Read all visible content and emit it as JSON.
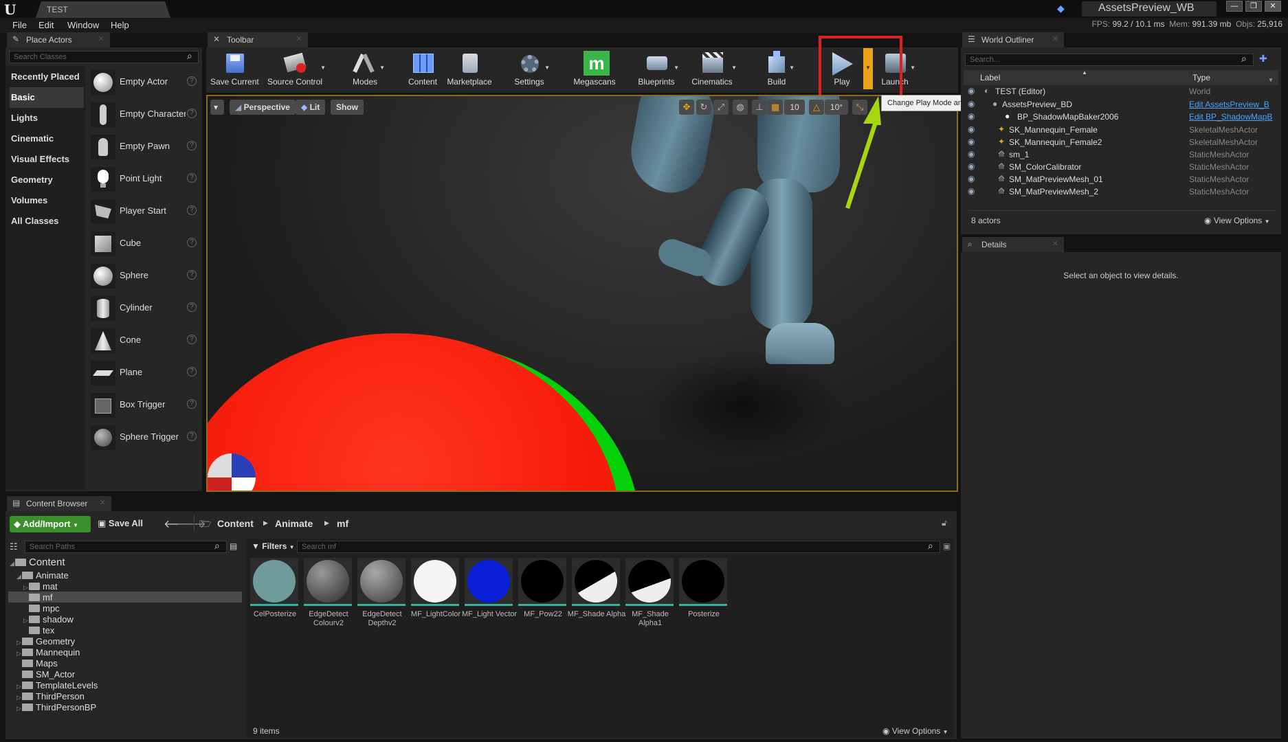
{
  "window": {
    "doc_tab": "TEST",
    "title": "AssetsPreview_WB",
    "controls": [
      "—",
      "❐",
      "✕"
    ]
  },
  "menu": [
    "File",
    "Edit",
    "Window",
    "Help"
  ],
  "stats": {
    "fps_label": "FPS:",
    "fps": "99.2",
    "ms": "/ 10.1 ms",
    "mem_label": "Mem:",
    "mem": "991.39 mb",
    "objs_label": "Objs:",
    "objs": "25,916"
  },
  "place_actors": {
    "tab": "Place Actors",
    "search_placeholder": "Search Classes",
    "categories": [
      "Recently Placed",
      "Basic",
      "Lights",
      "Cinematic",
      "Visual Effects",
      "Geometry",
      "Volumes",
      "All Classes"
    ],
    "selected_category": "Basic",
    "actors": [
      "Empty Actor",
      "Empty Character",
      "Empty Pawn",
      "Point Light",
      "Player Start",
      "Cube",
      "Sphere",
      "Cylinder",
      "Cone",
      "Plane",
      "Box Trigger",
      "Sphere Trigger"
    ]
  },
  "toolbar": {
    "tab": "Toolbar",
    "buttons": [
      "Save Current",
      "Source Control",
      "Modes",
      "Content",
      "Marketplace",
      "Settings",
      "Megascans",
      "Blueprints",
      "Cinematics",
      "Build",
      "Play",
      "Launch"
    ],
    "tooltip": "Change Play Mode and Play Settings"
  },
  "viewport": {
    "perspective": "Perspective",
    "lit": "Lit",
    "show": "Show",
    "grid_snap": "10",
    "rot_snap": "10°"
  },
  "outliner": {
    "tab": "World Outliner",
    "search_placeholder": "Search...",
    "col_label": "Label",
    "col_type": "Type",
    "rows": [
      {
        "label": "TEST (Editor)",
        "type": "World",
        "link": false
      },
      {
        "label": "AssetsPreview_BD",
        "type": "Edit AssetsPreview_B",
        "link": true
      },
      {
        "label": "BP_ShadowMapBaker2006",
        "type": "Edit BP_ShadowMapB",
        "link": true
      },
      {
        "label": "SK_Mannequin_Female",
        "type": "SkeletalMeshActor",
        "link": false
      },
      {
        "label": "SK_Mannequin_Female2",
        "type": "SkeletalMeshActor",
        "link": false
      },
      {
        "label": "sm_1",
        "type": "StaticMeshActor",
        "link": false
      },
      {
        "label": "SM_ColorCalibrator",
        "type": "StaticMeshActor",
        "link": false
      },
      {
        "label": "SM_MatPreviewMesh_01",
        "type": "StaticMeshActor",
        "link": false
      },
      {
        "label": "SM_MatPreviewMesh_2",
        "type": "StaticMeshActor",
        "link": false
      }
    ],
    "count": "8 actors",
    "view_options": "View Options"
  },
  "details": {
    "tab": "Details",
    "empty": "Select an object to view details."
  },
  "content_browser": {
    "tab": "Content Browser",
    "add_import": "Add/Import",
    "save_all": "Save All",
    "path": [
      "Content",
      "Animate",
      "mf"
    ],
    "search_paths": "Search Paths",
    "filters": "Filters",
    "search_placeholder": "Search mf",
    "tree": [
      {
        "name": "Content",
        "depth": 0
      },
      {
        "name": "Animate",
        "depth": 1
      },
      {
        "name": "mat",
        "depth": 2
      },
      {
        "name": "mf",
        "depth": 2
      },
      {
        "name": "mpc",
        "depth": 2
      },
      {
        "name": "shadow",
        "depth": 2
      },
      {
        "name": "tex",
        "depth": 2
      },
      {
        "name": "Geometry",
        "depth": 1
      },
      {
        "name": "Mannequin",
        "depth": 1
      },
      {
        "name": "Maps",
        "depth": 1
      },
      {
        "name": "SM_Actor",
        "depth": 1
      },
      {
        "name": "TemplateLevels",
        "depth": 1
      },
      {
        "name": "ThirdPerson",
        "depth": 1
      },
      {
        "name": "ThirdPersonBP",
        "depth": 1
      }
    ],
    "assets": [
      {
        "name": "CelPosterize",
        "color": "#6f9c9a"
      },
      {
        "name": "EdgeDetect Colourv2",
        "color": "#5a5a5a"
      },
      {
        "name": "EdgeDetect Depthv2",
        "color": "#6a6a6a"
      },
      {
        "name": "MF_LightColor",
        "color": "#f5f5f5"
      },
      {
        "name": "MF_Light Vector",
        "color": "#0a1fd8"
      },
      {
        "name": "MF_Pow22",
        "color": "#000000"
      },
      {
        "name": "MF_Shade Alpha",
        "color": "#000000"
      },
      {
        "name": "MF_Shade Alpha1",
        "color": "#000000"
      },
      {
        "name": "Posterize",
        "color": "#000000"
      }
    ],
    "count": "9 items",
    "view_options": "View Options"
  },
  "colors": {
    "accent_green": "#3a8f2a",
    "highlight_red": "#e02020",
    "play_orange": "#e8a317"
  }
}
